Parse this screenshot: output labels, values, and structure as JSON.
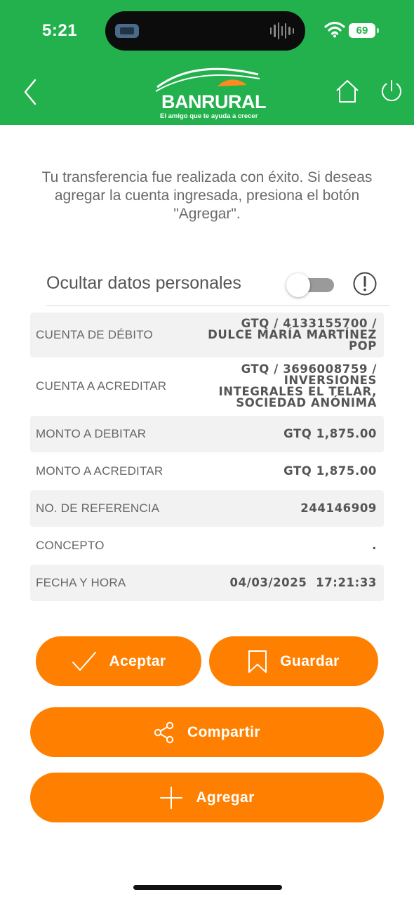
{
  "status_bar": {
    "time": "5:21",
    "battery": "69"
  },
  "header": {
    "brand_name": "BANRURAL",
    "tagline": "El amigo que te ayuda a crecer",
    "back_icon": "chevron-left-icon",
    "home_icon": "home-icon",
    "power_icon": "power-icon",
    "colors": {
      "header_bg": "#22b14c",
      "accent": "#ff8000"
    }
  },
  "message": "Tu transferencia fue realizada con éxito. Si deseas agregar la cuenta ingresada, presiona el botón \"Agregar\".",
  "privacy_toggle": {
    "label": "Ocultar datos personales",
    "enabled": false
  },
  "details": [
    {
      "label": "CUENTA DE DÉBITO",
      "value": [
        "GTQ / 4133155700 /",
        "DULCE MARÍA MARTÍNEZ",
        "POP"
      ]
    },
    {
      "label": "CUENTA A ACREDITAR",
      "value": [
        "GTQ / 3696008759 /",
        "INVERSIONES",
        "INTEGRALES EL TELAR,",
        "SOCIEDAD ANÓNIMA"
      ]
    },
    {
      "label": "MONTO A DEBITAR",
      "value": [
        "GTQ 1,875.00"
      ]
    },
    {
      "label": "MONTO A ACREDITAR",
      "value": [
        "GTQ 1,875.00"
      ]
    },
    {
      "label": "NO. DE REFERENCIA",
      "value": [
        "244146909"
      ]
    },
    {
      "label": "CONCEPTO",
      "value": [
        "."
      ]
    },
    {
      "label": "FECHA Y HORA",
      "value": [
        "04/03/2025  17:21:33"
      ]
    }
  ],
  "buttons": {
    "accept": "Aceptar",
    "save": "Guardar",
    "share": "Compartir",
    "add": "Agregar"
  }
}
